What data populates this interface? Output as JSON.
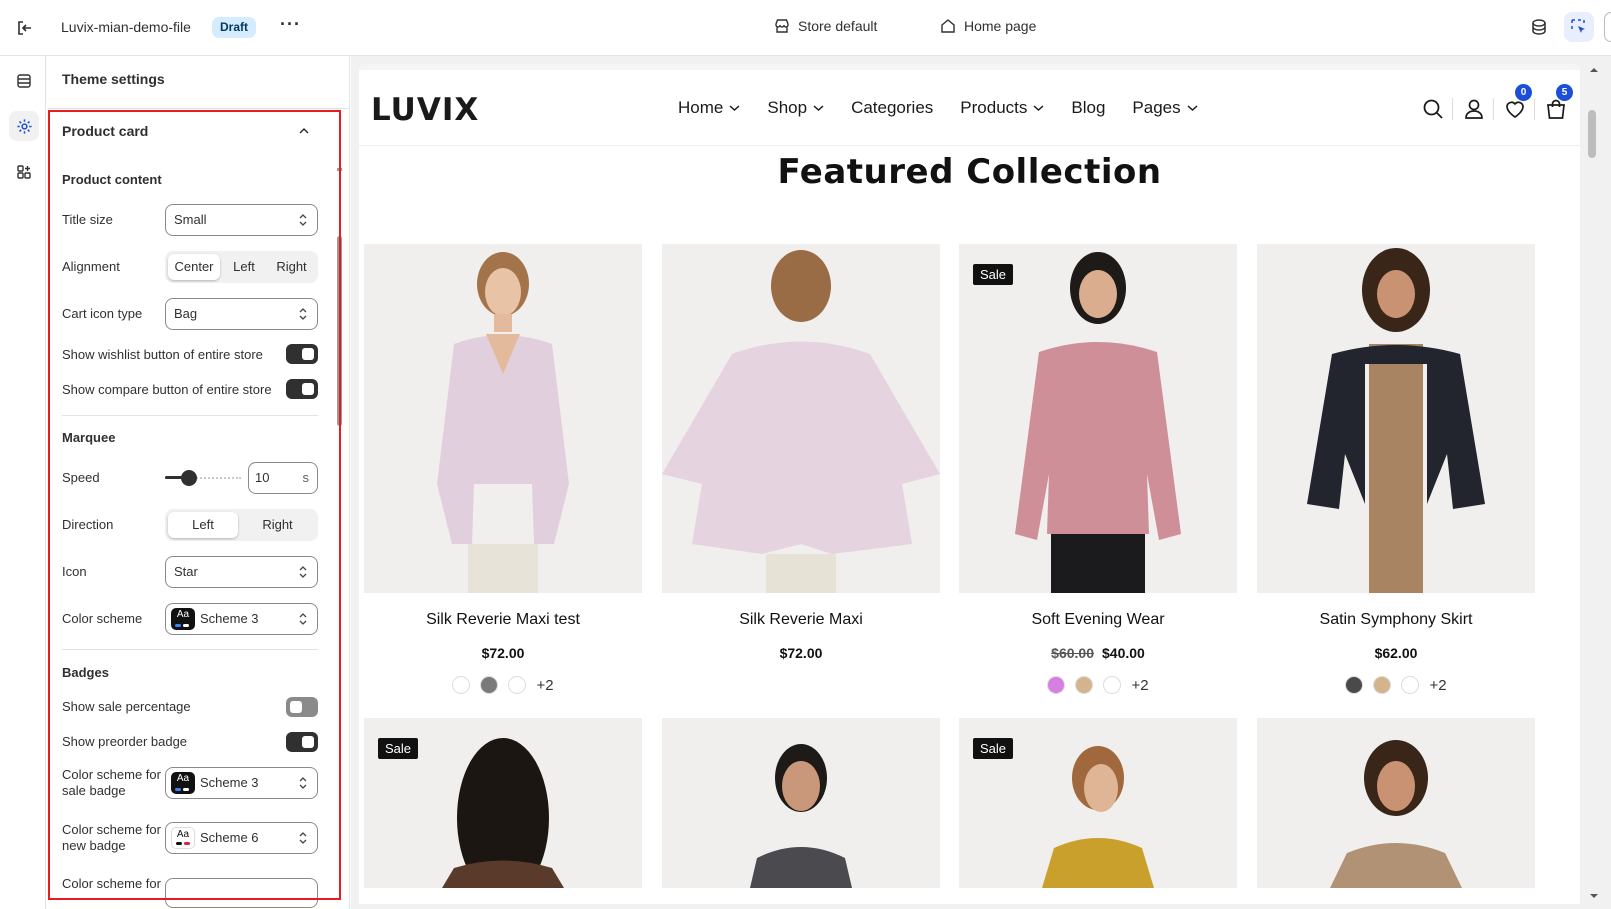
{
  "topbar": {
    "file_name": "Luvix-mian-demo-file",
    "status_badge": "Draft",
    "more_label": "···",
    "store_label": "Store default",
    "page_label": "Home page"
  },
  "panel": {
    "title": "Theme settings",
    "section_title": "Product card",
    "product_content": {
      "heading": "Product content",
      "title_size_label": "Title size",
      "title_size_value": "Small",
      "alignment_label": "Alignment",
      "alignment_options": [
        "Center",
        "Left",
        "Right"
      ],
      "alignment_selected": "Center",
      "cart_icon_label": "Cart icon type",
      "cart_icon_value": "Bag",
      "wishlist_label": "Show wishlist button of entire store",
      "wishlist_on": true,
      "compare_label": "Show compare button of entire store",
      "compare_on": true
    },
    "marquee": {
      "heading": "Marquee",
      "speed_label": "Speed",
      "speed_value": "10",
      "speed_unit": "s",
      "direction_label": "Direction",
      "direction_options": [
        "Left",
        "Right"
      ],
      "direction_selected": "Left",
      "icon_label": "Icon",
      "icon_value": "Star",
      "color_scheme_label": "Color scheme",
      "color_scheme_value": "Scheme 3"
    },
    "badges": {
      "heading": "Badges",
      "sale_pct_label": "Show sale percentage",
      "sale_pct_on": false,
      "preorder_label": "Show preorder badge",
      "preorder_on": true,
      "sale_scheme_label_1": "Color scheme for",
      "sale_scheme_label_2": "sale badge",
      "sale_scheme_value": "Scheme 3",
      "new_scheme_label_1": "Color scheme for",
      "new_scheme_label_2": "new badge",
      "new_scheme_value": "Scheme 6",
      "next_label": "Color scheme for"
    },
    "swatch_text": "Aa"
  },
  "preview": {
    "logo": "LUVIX",
    "nav": [
      "Home",
      "Shop",
      "Categories",
      "Products",
      "Blog",
      "Pages"
    ],
    "wishlist_count": "0",
    "cart_count": "5",
    "section_title": "Featured Collection",
    "products": [
      {
        "name": "Silk Reverie Maxi test",
        "price": "$72.00",
        "compare_price": "",
        "sale": false,
        "swatches": [
          "#ffffff",
          "#7a7a7a",
          "#ffffff"
        ],
        "more": "+2"
      },
      {
        "name": "Silk Reverie Maxi",
        "price": "$72.00",
        "compare_price": "",
        "sale": false,
        "swatches": [],
        "more": ""
      },
      {
        "name": "Soft Evening Wear",
        "price": "$40.00",
        "compare_price": "$60.00",
        "sale": true,
        "swatches": [
          "#d77ee0",
          "#d4b48c",
          "#ffffff"
        ],
        "more": "+2"
      },
      {
        "name": "Satin Symphony Skirt",
        "price": "$62.00",
        "compare_price": "",
        "sale": false,
        "swatches": [
          "#4a4a4a",
          "#d4b48c",
          "#ffffff"
        ],
        "more": "+2"
      }
    ],
    "sale_label": "Sale"
  },
  "colors": {
    "accent": "#1d4ed8",
    "highlight_border": "#e51c23",
    "draft_bg": "#d5ebff"
  }
}
